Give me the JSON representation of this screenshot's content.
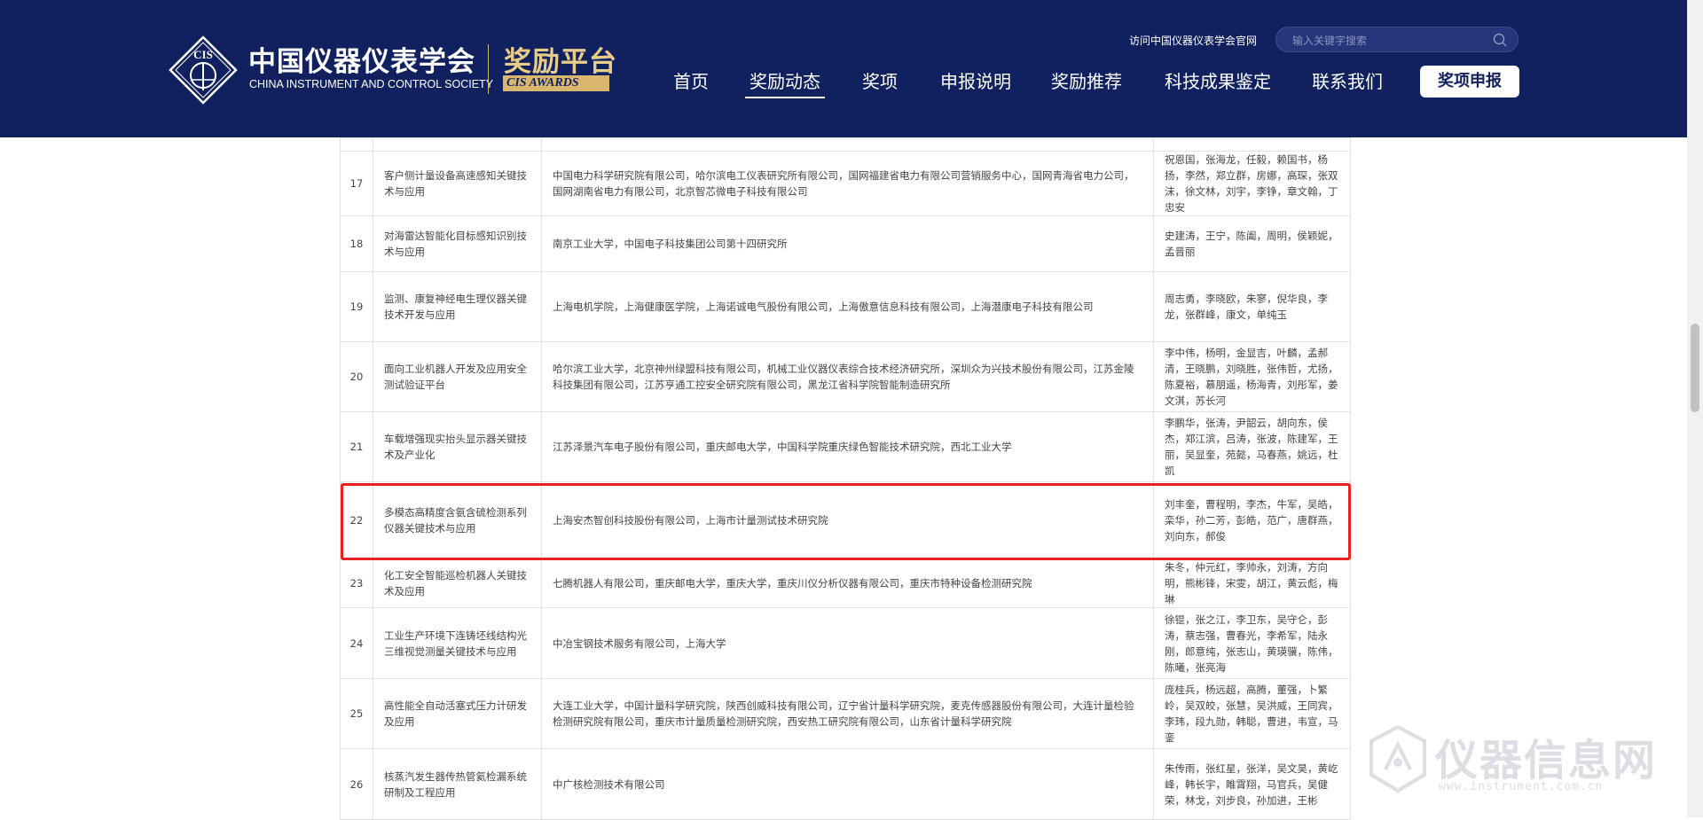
{
  "header": {
    "logo": {
      "emblem_text": "CIS",
      "name_cn": "中国仪器仪表学会",
      "name_en": "CHINA INSTRUMENT AND CONTROL SOCIETY",
      "platform_cn": "奖励平台",
      "platform_en": "CIS AWARDS"
    },
    "visit_link": "访问中国仪器仪表学会官网",
    "search": {
      "placeholder": "输入关键字搜索",
      "value": ""
    },
    "nav": [
      {
        "label": "首页",
        "active": false
      },
      {
        "label": "奖励动态",
        "active": true
      },
      {
        "label": "奖项",
        "active": false
      },
      {
        "label": "申报说明",
        "active": false
      },
      {
        "label": "奖励推荐",
        "active": false
      },
      {
        "label": "科技成果鉴定",
        "active": false
      },
      {
        "label": "联系我们",
        "active": false
      }
    ],
    "cta_label": "奖项申报",
    "colors": {
      "header_bg": "#11215f",
      "gold": "#d9b76e",
      "highlight": "#e8201f"
    }
  },
  "table": {
    "rows": [
      {
        "no": "17",
        "project": "客户侧计量设备高速感知关键技术与应用",
        "units": "中国电力科学研究院有限公司，哈尔滨电工仪表研究所有限公司，国网福建省电力有限公司营销服务中心，国网青海省电力公司，国网湖南省电力有限公司，北京智芯微电子科技有限公司",
        "people": "祝恩国，张海龙，任毅，赖国书，杨扬，李然，郑立群，房娜，高琛，张双沫，徐文林，刘宇，李铮，章文翰，丁忠安"
      },
      {
        "no": "18",
        "project": "对海雷达智能化目标感知识别技术与应用",
        "units": "南京工业大学，中国电子科技集团公司第十四研究所",
        "people": "史建涛，王宁，陈阖，周明，侯颖妮，孟晋丽"
      },
      {
        "no": "19",
        "project": "监测、康复神经电生理仪器关键技术开发与应用",
        "units": "上海电机学院，上海健康医学院，上海诺诚电气股份有限公司，上海傲意信息科技有限公司，上海潜康电子科技有限公司",
        "people": "周志勇，李晓欧，朱寥，倪华良，李龙，张群峰，康文，单纯玉"
      },
      {
        "no": "20",
        "project": "面向工业机器人开发及应用安全测试验证平台",
        "units": "哈尔滨工业大学，北京神州绿盟科技有限公司，机械工业仪器仪表综合技术经济研究所，深圳众为兴技术股份有限公司，江苏金陵科技集团有限公司，江苏亨通工控安全研究院有限公司，黑龙江省科学院智能制造研究所",
        "people": "李中伟，杨明，金显吉，叶麟，孟郝清，王晓鹏，刘晓胜，张伟哲，尤扬，陈夏裕，慕朋遥，杨海青，刘彤军，姜文淇，苏长河"
      },
      {
        "no": "21",
        "project": "车载增强现实抬头显示器关键技术及产业化",
        "units": "江苏泽景汽车电子股份有限公司，重庆邮电大学，中国科学院重庆绿色智能技术研究院，西北工业大学",
        "people": "李鹏华，张涛，尹韶云，胡向东，侯杰，郑江滨，吕涛，张波，陈建军，王丽，吴显奎，苑懿，马春燕，姚远，杜凯"
      },
      {
        "no": "22",
        "project": "多模态高精度含氨含硫检测系列仪器关键技术与应用",
        "units": "上海安杰智创科技股份有限公司，上海市计量测试技术研究院",
        "people": "刘丰奎，曹程明，李杰，牛军，吴皓，栾华，孙二芳，彭皓，范广，唐群燕，刘向东，郝俊"
      },
      {
        "no": "23",
        "project": "化工安全智能巡检机器人关键技术及应用",
        "units": "七腾机器人有限公司，重庆邮电大学，重庆大学，重庆川仪分析仪器有限公司，重庆市特种设备检测研究院",
        "people": "朱冬，仲元红，李帅永，刘涛，方向明，熊彬锋，宋雯，胡江，黄云彪，梅琳"
      },
      {
        "no": "24",
        "project": "工业生产环境下连铸坯线结构光三维视觉测量关键技术与应用",
        "units": "中冶宝钢技术服务有限公司，上海大学",
        "people": "徐锟，张之江，李卫东，吴守仑，彭涛，蔡志强，曹春光，李希军，陆永刚，郎意纯，张志山，黄瑛骥，陈伟，陈曦，张亮海"
      },
      {
        "no": "25",
        "project": "高性能全自动活塞式压力计研发及应用",
        "units": "大连工业大学，中国计量科学研究院，陕西创威科技有限公司，辽宁省计量科学研究院，麦克传感器股份有限公司，大连计量检验检测研究院有限公司，重庆市计量质量检测研究院，西安热工研究院有限公司，山东省计量科学研究院",
        "people": "庞桂兵，杨远超，高腾，董强，卜繁岭，吴双皎，张慧，吴洪威，王同宾，李玮，段九勋，韩聪，曹进，韦宣，马銮"
      },
      {
        "no": "26",
        "project": "核蒸汽发生器传热管氦检漏系统研制及工程应用",
        "units": "中广核检测技术有限公司",
        "people": "朱传雨，张红星，张洋，吴文昊，黄屹峰，韩长宇，睢霄翔，马官兵，吴健荣，林戈，刘步良，孙加进，王彬"
      }
    ]
  },
  "watermark": {
    "text": "仪器信息网",
    "url": "www.instrument.com.cn"
  }
}
